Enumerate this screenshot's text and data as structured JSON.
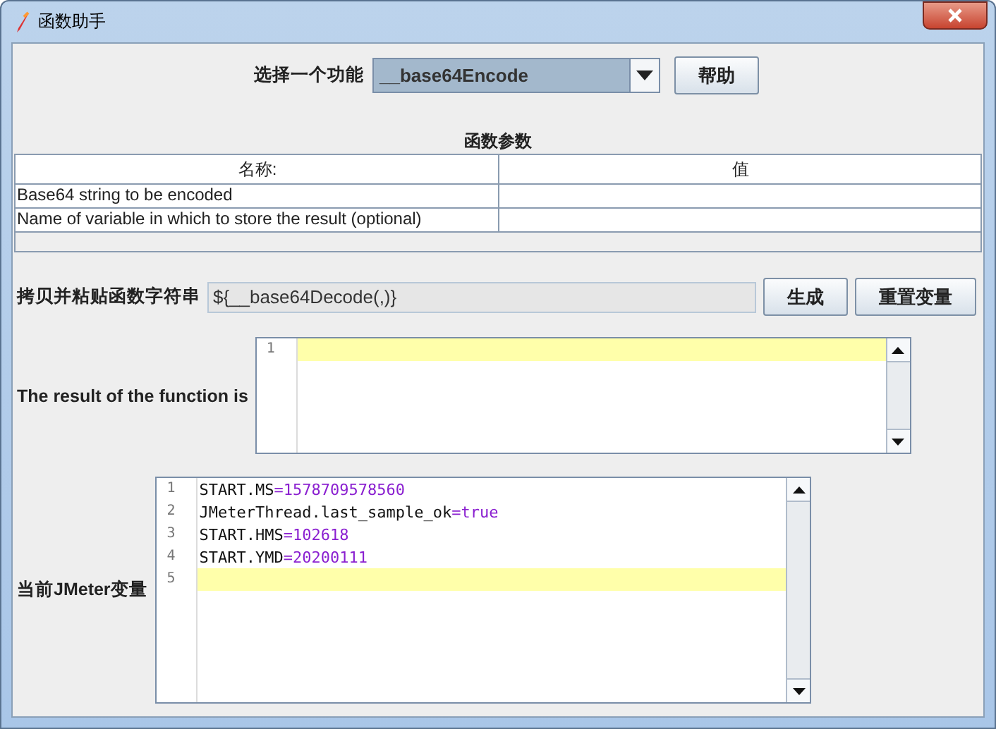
{
  "window": {
    "title": "函数助手"
  },
  "function_select": {
    "label": "选择一个功能",
    "value": "__base64Encode",
    "help_button": "帮助"
  },
  "parameters": {
    "title": "函数参数",
    "columns": [
      "名称:",
      "值"
    ],
    "rows": [
      {
        "name": "Base64 string to be encoded"
      },
      {
        "name": "Name of variable in which to store the result (optional)"
      }
    ]
  },
  "function_string": {
    "label": "拷贝并粘贴函数字符串",
    "value": "${__base64Decode(,)}",
    "buttons": [
      "生成",
      "重置变量"
    ]
  },
  "result": {
    "label": "The result of the function is",
    "lines": [
      {
        "number": "1",
        "current": true
      }
    ]
  },
  "variables": {
    "label": "当前JMeter变量",
    "lines": [
      {
        "number": "1",
        "key": "START.MS",
        "sep": "=",
        "value": "1578709578560",
        "current": false
      },
      {
        "number": "2",
        "key": "JMeterThread.last_sample_ok",
        "sep": "=",
        "value": "true",
        "current": false
      },
      {
        "number": "3",
        "key": "START.HMS",
        "sep": "=",
        "value": "102618",
        "current": false
      },
      {
        "number": "4",
        "key": "START.YMD",
        "sep": "=",
        "value": "20200111",
        "current": false
      },
      {
        "number": "5",
        "current": true
      }
    ]
  }
}
